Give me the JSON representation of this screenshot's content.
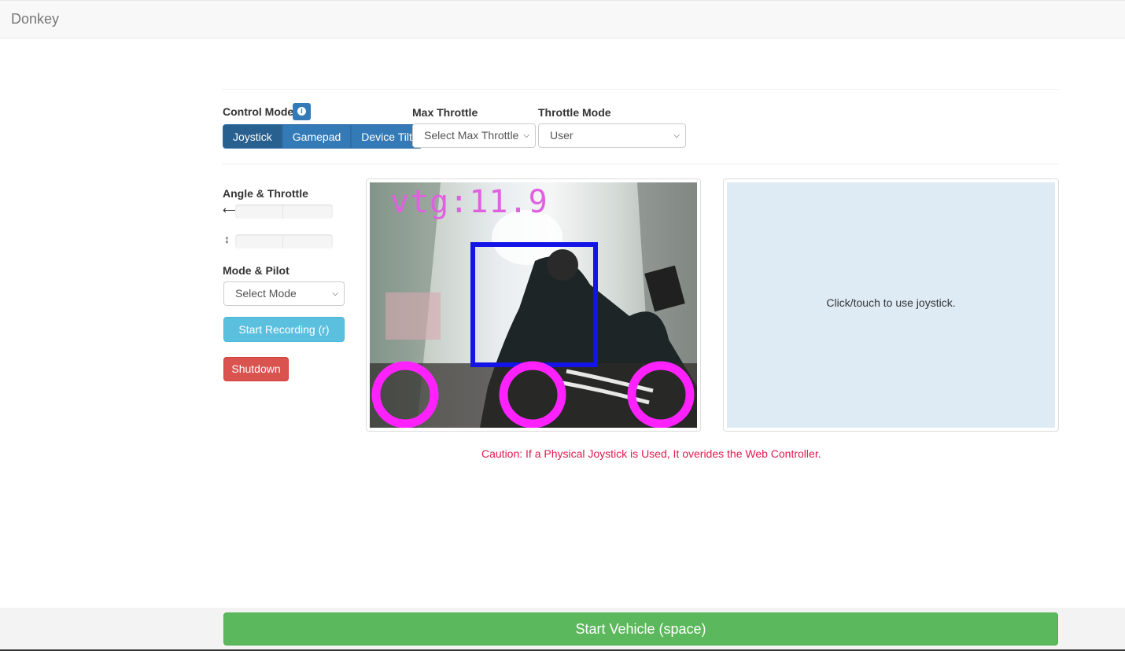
{
  "navbar": {
    "brand": "Donkey"
  },
  "controls": {
    "control_mode_label": "Control Mode",
    "control_mode_buttons": [
      "Joystick",
      "Gamepad",
      "Device Tilt"
    ],
    "max_throttle_label": "Max Throttle",
    "max_throttle_value": "Select Max Throttle",
    "throttle_mode_label": "Throttle Mode",
    "throttle_mode_value": "User"
  },
  "left": {
    "angle_throttle_label": "Angle & Throttle",
    "mode_pilot_label": "Mode & Pilot",
    "mode_select_value": "Select Mode",
    "record_button": "Start Recording (r)",
    "shutdown_button": "Shutdown"
  },
  "camera": {
    "overlay_text": "vtg:11.9"
  },
  "joystick": {
    "hint": "Click/touch to use joystick."
  },
  "caution": "Caution: If a Physical Joystick is Used, It overides the Web Controller.",
  "footer": {
    "start_button": "Start Vehicle (space)"
  },
  "colors": {
    "primary": "#337ab7",
    "info": "#5bc0de",
    "danger": "#d9534f",
    "success": "#5cb85c",
    "caution": "#e0194f"
  }
}
